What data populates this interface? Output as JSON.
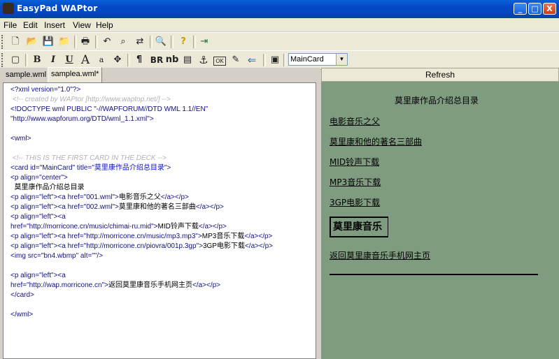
{
  "window": {
    "title": "EasyPad WAPtor",
    "min_label": "_",
    "max_label": "□",
    "close_label": "X"
  },
  "menu": [
    "File",
    "Edit",
    "Insert",
    "View",
    "Help"
  ],
  "toolbar1": {
    "icons": [
      "new-file-icon",
      "open-folder-icon",
      "save-icon",
      "open-project-icon",
      "print-icon",
      "undo-icon",
      "find-icon",
      "replace-icon",
      "preview-icon",
      "help-icon",
      "exit-icon"
    ],
    "glyphs": [
      "🗋",
      "📂",
      "💾",
      "📁",
      "🖶",
      "↶",
      "⌕",
      "⇄",
      "🔍",
      "?",
      "⇥"
    ]
  },
  "toolbar2": {
    "buttons": [
      {
        "name": "card-icon",
        "label": "▢"
      },
      {
        "name": "bold-button",
        "label": "B"
      },
      {
        "name": "italic-button",
        "label": "I"
      },
      {
        "name": "underline-button",
        "label": "U"
      },
      {
        "name": "big-font-button",
        "label": "A"
      },
      {
        "name": "small-font-button",
        "label": "a"
      },
      {
        "name": "center-icon",
        "label": "✥"
      },
      {
        "name": "paragraph-button",
        "label": "¶"
      },
      {
        "name": "br-button",
        "label": "BR"
      },
      {
        "name": "nb-button",
        "label": "nb"
      },
      {
        "name": "table-icon",
        "label": "▤"
      },
      {
        "name": "anchor-icon",
        "label": "⚓"
      },
      {
        "name": "ok-button",
        "label": "OK"
      },
      {
        "name": "edit-form-icon",
        "label": "✎"
      },
      {
        "name": "back-arrow-icon",
        "label": "⇐"
      },
      {
        "name": "cards-icon",
        "label": "▣"
      }
    ],
    "card_select": "MainCard"
  },
  "tabs": [
    "sample.wml",
    "samplea.wml*"
  ],
  "refresh_label": "Refresh",
  "code_lines": [
    [
      [
        "tg",
        "<?xml version=\"1.0\"?>"
      ]
    ],
    [
      [
        "cm",
        " <!-- created by WAPtor [http://www.waptop.net/] -->"
      ]
    ],
    [
      [
        "tg",
        "<!DOCTYPE wml PUBLIC \"-//WAPFORUM//DTD WML 1.1//EN\""
      ]
    ],
    [
      [
        "tg",
        "\"http://www.wapforum.org/DTD/wml_1.1.xml\">"
      ]
    ],
    [
      [
        "tx",
        ""
      ]
    ],
    [
      [
        "tg",
        "<wml>"
      ]
    ],
    [
      [
        "tx",
        ""
      ]
    ],
    [
      [
        "cm",
        " <!-- THIS IS THE FIRST CARD IN THE DECK -->"
      ]
    ],
    [
      [
        "tg",
        "<card id=\"MainCard\" title=\""
      ],
      [
        "vl",
        "莫里康作品介绍总目录"
      ],
      [
        "tg",
        "\">"
      ]
    ],
    [
      [
        "tg",
        "<p align=\"center\">"
      ]
    ],
    [
      [
        "tx",
        "  莫里康作品介绍总目录"
      ]
    ],
    [
      [
        "tg",
        "<p align=\"left\"><a href=\"001.wml\">"
      ],
      [
        "tx",
        "电影音乐之父"
      ],
      [
        "tg",
        "</a></p>"
      ]
    ],
    [
      [
        "tg",
        "<p align=\"left\"><a href=\"002.wml\">"
      ],
      [
        "tx",
        "莫里康和他的著名三部曲"
      ],
      [
        "tg",
        "</a></p>"
      ]
    ],
    [
      [
        "tg",
        "<p align=\"left\"><a"
      ]
    ],
    [
      [
        "tg",
        "href=\"http://morricone.cn/music/chimai-ru.mid\">"
      ],
      [
        "tx",
        "MID铃声下载"
      ],
      [
        "tg",
        "</a></p>"
      ]
    ],
    [
      [
        "tg",
        "<p align=\"left\"><a href=\"http://morricone.cn/music/mp3.mp3\">"
      ],
      [
        "tx",
        "MP3音乐下载"
      ],
      [
        "tg",
        "</a></p>"
      ]
    ],
    [
      [
        "tg",
        "<p align=\"left\"><a href=\"http://morricone.cn/piovra/001p.3gp\">"
      ],
      [
        "tx",
        "3GP电影下载"
      ],
      [
        "tg",
        "</a></p>"
      ]
    ],
    [
      [
        "tg",
        "<img src=\"bn4.wbmp\" alt=\"\"/>"
      ]
    ],
    [
      [
        "tx",
        ""
      ]
    ],
    [
      [
        "tg",
        "<p align=\"left\"><a"
      ]
    ],
    [
      [
        "tg",
        "href=\"http://wap.morricone.cn\">"
      ],
      [
        "tx",
        "返回莫里康音乐手机网主页"
      ],
      [
        "tg",
        "</a></p>"
      ]
    ],
    [
      [
        "tg",
        "</card>"
      ]
    ],
    [
      [
        "tx",
        ""
      ]
    ],
    [
      [
        "tg",
        "</wml>"
      ]
    ]
  ],
  "preview": {
    "title": "莫里康作品介绍总目录",
    "links": [
      "电影音乐之父",
      "莫里康和他的著名三部曲",
      "MID铃声下载",
      "MP3音乐下载",
      "3GP电影下载"
    ],
    "image_text": "莫里康音乐",
    "home_link": "返回莫里康音乐手机网主页"
  }
}
